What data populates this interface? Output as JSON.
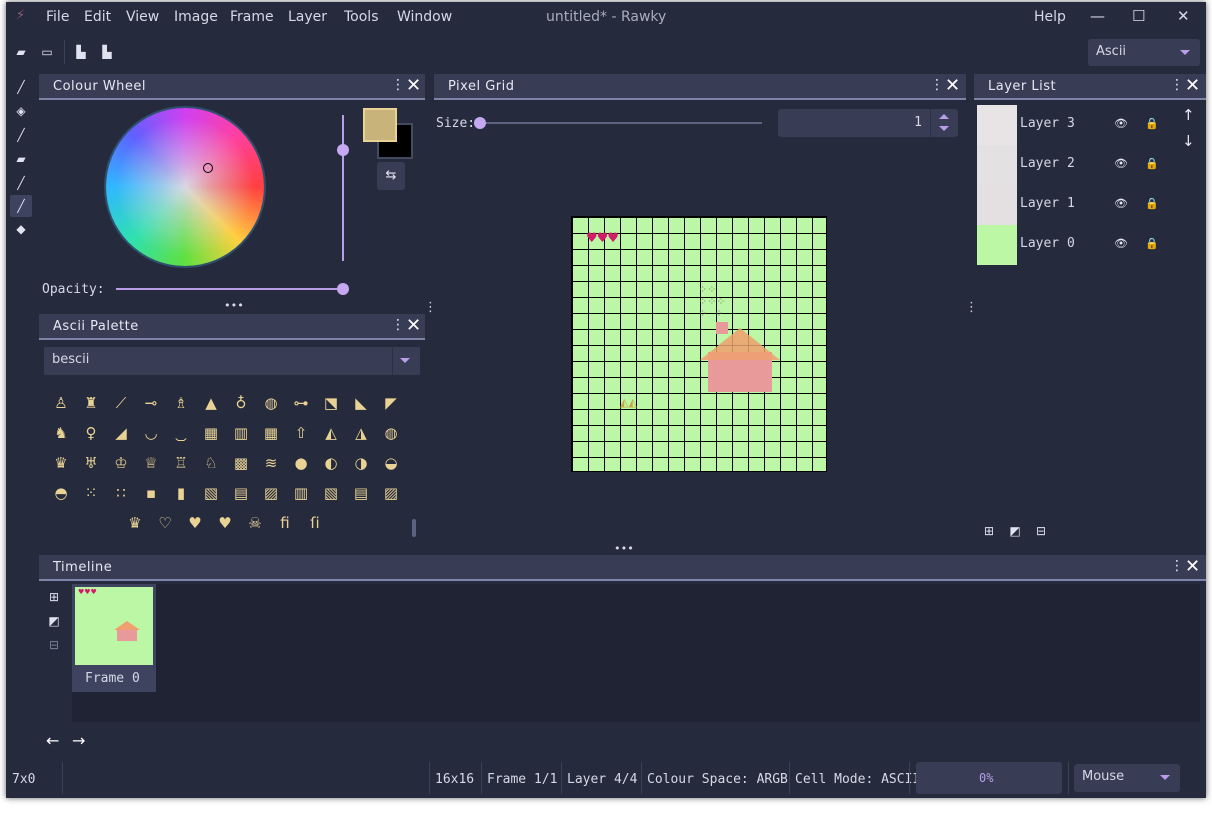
{
  "window": {
    "title": "untitled* - Rawky",
    "menu": [
      "File",
      "Edit",
      "View",
      "Image",
      "Frame",
      "Layer",
      "Tools",
      "Window"
    ],
    "help": "Help",
    "controls": {
      "minimize": "—",
      "maximize": "☐",
      "close": "✕"
    }
  },
  "toolbar": {
    "mode_dropdown": "Ascii"
  },
  "colour_wheel": {
    "title": "Colour Wheel",
    "opacity_label": "Opacity:",
    "primary_colour": "#c8b47a",
    "secondary_colour": "#000000"
  },
  "ascii_palette": {
    "title": "Ascii Palette",
    "palette_select": "bescii",
    "glyphs": [
      "♙",
      "♜",
      "⟋",
      "⊸",
      "♗",
      "▲",
      "♁",
      "◍",
      "⊶",
      "⬔",
      "◣",
      "◤",
      "♞",
      "♀",
      "◢",
      "◡",
      "⏡",
      "▦",
      "▥",
      "▦",
      "⇧",
      "◭",
      "◮",
      "◍",
      "♛",
      "♅",
      "♔",
      "♕",
      "♖",
      "♘",
      "▩",
      "≋",
      "●",
      "◐",
      "◑",
      "◒",
      "◓",
      "⁙",
      "∷",
      "▪",
      "▮",
      "▧",
      "▤",
      "▨",
      "▥",
      "▧",
      "▤",
      "▨",
      "♛",
      "♡",
      "♥",
      "♥",
      "☠",
      "fi",
      "ſi"
    ]
  },
  "pixel_grid": {
    "title": "Pixel Grid",
    "size_label": "Size:",
    "size_value": "1"
  },
  "layer_list": {
    "title": "Layer List",
    "layers": [
      {
        "name": "Layer 3",
        "thumb": "#e8e4e6"
      },
      {
        "name": "Layer 2",
        "thumb": "#e4e1e3"
      },
      {
        "name": "Layer 1",
        "thumb": "#e4dfe1"
      },
      {
        "name": "Layer 0",
        "thumb": "#bbf7a4"
      }
    ]
  },
  "timeline": {
    "title": "Timeline",
    "frames": [
      {
        "label": "Frame 0"
      }
    ]
  },
  "status": {
    "cursor": "7x0",
    "size": "16x16",
    "frame": "Frame 1/1",
    "layer": "Layer 4/4",
    "colour_space": "Colour Space: ARGB",
    "cell_mode": "Cell Mode: ASCII",
    "progress": "0%",
    "input_mode": "Mouse"
  },
  "colors": {
    "background": "#252a3c",
    "panel_header": "#383d55",
    "accent": "#b89ee8",
    "canvas": "#bbf7a4",
    "glyph": "#e8d294"
  }
}
